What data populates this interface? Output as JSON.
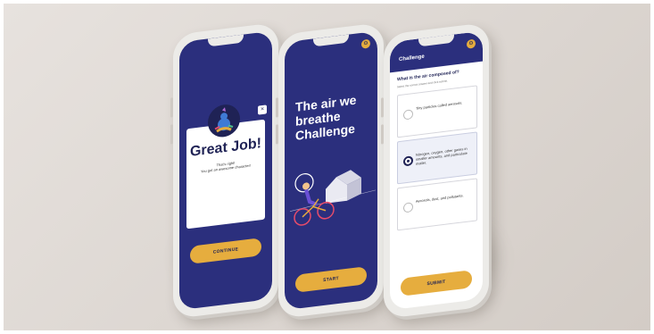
{
  "colors": {
    "navy": "#2b2f7d",
    "gold": "#e6ad3e",
    "background": "#ddd7d2"
  },
  "phone1": {
    "close_label": "×",
    "title": "Great Job!",
    "message_line1": "That's right!",
    "message_line2": "You got an awesome character!",
    "continue_label": "CONTINUE"
  },
  "phone2": {
    "headline_line1": "The air we",
    "headline_line2": "breathe",
    "headline_line3": "Challenge",
    "start_label": "START",
    "corner_icon": "settings-icon"
  },
  "phone3": {
    "header_title": "Challenge",
    "question": "What is the air composed of?",
    "instruction": "Select the correct answer and click submit.",
    "options": [
      {
        "text": "Tiny particles called aerosols.",
        "selected": false
      },
      {
        "text": "Nitrogen, oxygen, other gases in smaller amounts, and particulate matter.",
        "selected": true
      },
      {
        "text": "Aerosols, dust, and pollutants.",
        "selected": false
      }
    ],
    "submit_label": "SUBMIT"
  }
}
